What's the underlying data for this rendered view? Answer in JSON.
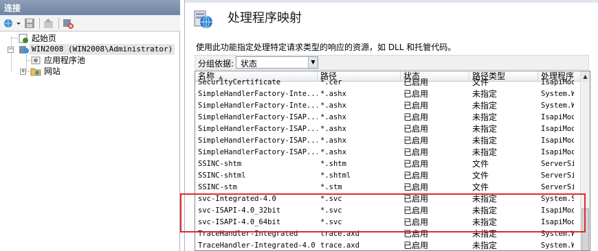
{
  "connections": {
    "title": "连接",
    "toolbar": [
      "connect-icon",
      "save-icon",
      "up-icon",
      "disconnect-icon"
    ],
    "tree": {
      "start_page": "起始页",
      "server": "WIN2008 (WIN2008\\Administrator)",
      "app_pools": "应用程序池",
      "sites": "网站"
    }
  },
  "main": {
    "title": "处理程序映射",
    "description": "使用此功能指定处理特定请求类型的响应的资源，如 DLL 和托管代码。",
    "group_by_label": "分组依据:",
    "group_by_value": "状态",
    "columns": [
      "名称",
      "路径",
      "状态",
      "路径类型",
      "处理程序"
    ],
    "rows": [
      [
        "SecurityCertificate",
        "*.cer",
        "已启用",
        "文件",
        "IsapiMod"
      ],
      [
        "SimpleHandlerFactory-Inte...",
        "*.ashx",
        "已启用",
        "未指定",
        "System.W"
      ],
      [
        "SimpleHandlerFactory-Inte...",
        "*.ashx",
        "已启用",
        "未指定",
        "System.W"
      ],
      [
        "SimpleHandlerFactory-ISAP...",
        "*.ashx",
        "已启用",
        "未指定",
        "IsapiMod"
      ],
      [
        "SimpleHandlerFactory-ISAP...",
        "*.ashx",
        "已启用",
        "未指定",
        "IsapiMod"
      ],
      [
        "SimpleHandlerFactory-ISAP...",
        "*.ashx",
        "已启用",
        "未指定",
        "IsapiMod"
      ],
      [
        "SimpleHandlerFactory-ISAP...",
        "*.ashx",
        "已启用",
        "未指定",
        "IsapiMod"
      ],
      [
        "SSINC-shtm",
        "*.shtm",
        "已启用",
        "文件",
        "ServerSi"
      ],
      [
        "SSINC-shtml",
        "*.shtml",
        "已启用",
        "文件",
        "ServerSi"
      ],
      [
        "SSINC-stm",
        "*.stm",
        "已启用",
        "文件",
        "ServerSi"
      ],
      [
        "svc-Integrated-4.0",
        "*.svc",
        "已启用",
        "未指定",
        "System.S"
      ],
      [
        "svc-ISAPI-4.0_32bit",
        "*.svc",
        "已启用",
        "未指定",
        "IsapiMod"
      ],
      [
        "svc-ISAPI-4.0_64bit",
        "*.svc",
        "已启用",
        "未指定",
        "IsapiMod"
      ],
      [
        "TraceHandler-Integrated",
        "trace.axd",
        "已启用",
        "未指定",
        "System.W"
      ],
      [
        "TraceHandler-Integrated-4.0",
        "trace.axd",
        "已启用",
        "未指定",
        "System.W"
      ]
    ]
  },
  "colors": {
    "header_bar": "#7a8fae",
    "highlight": "#e3262c",
    "list_border": "#828790"
  }
}
